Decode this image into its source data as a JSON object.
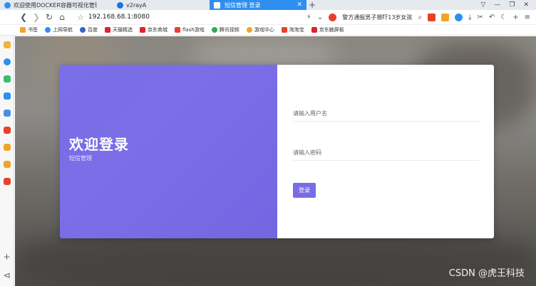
{
  "tabs": [
    {
      "label": "欢迎使用DOCKER容器可视化管理主",
      "color": "#2e8ff0"
    },
    {
      "label": "v2rayA",
      "color": "#1a73e8"
    },
    {
      "label": "短信管理 登录",
      "color": "#ffffff"
    }
  ],
  "window": {
    "ctrl_restore": "⧉",
    "ctrl_min": "—",
    "ctrl_max": "❐",
    "ctrl_close": "✕"
  },
  "address": {
    "url": "192.168.68.1:8080",
    "news": "警方通报男子猥吓13岁女孩"
  },
  "bookmarks": [
    {
      "label": "书签",
      "color": "#f2a32a"
    },
    {
      "label": "上网导航",
      "color": "#2e8ff0"
    },
    {
      "label": "百度",
      "color": "#3467c9"
    },
    {
      "label": "天猫精选",
      "color": "#d8262c"
    },
    {
      "label": "京东商城",
      "color": "#d8262c"
    },
    {
      "label": "flash游戏",
      "color": "#e6412b"
    },
    {
      "label": "腾讯视频",
      "color": "#34a853"
    },
    {
      "label": "游戏中心",
      "color": "#f2a32a"
    },
    {
      "label": "淘淘宝",
      "color": "#e6412b"
    },
    {
      "label": "京东触屏板",
      "color": "#d8262c"
    }
  ],
  "sidebar_colors": [
    "#f2b33a",
    "#2e8ff0",
    "#34c06a",
    "#2e8ff0",
    "#4a90e2",
    "#e6412b",
    "#f2a32a",
    "#f2a32a",
    "#e6412b"
  ],
  "login": {
    "welcome": "欢迎登录",
    "subtitle": "短信管理",
    "username_placeholder": "请输入用户名",
    "password_placeholder": "请输入密码",
    "button": "登录"
  },
  "watermark": "CSDN @虎王科技"
}
